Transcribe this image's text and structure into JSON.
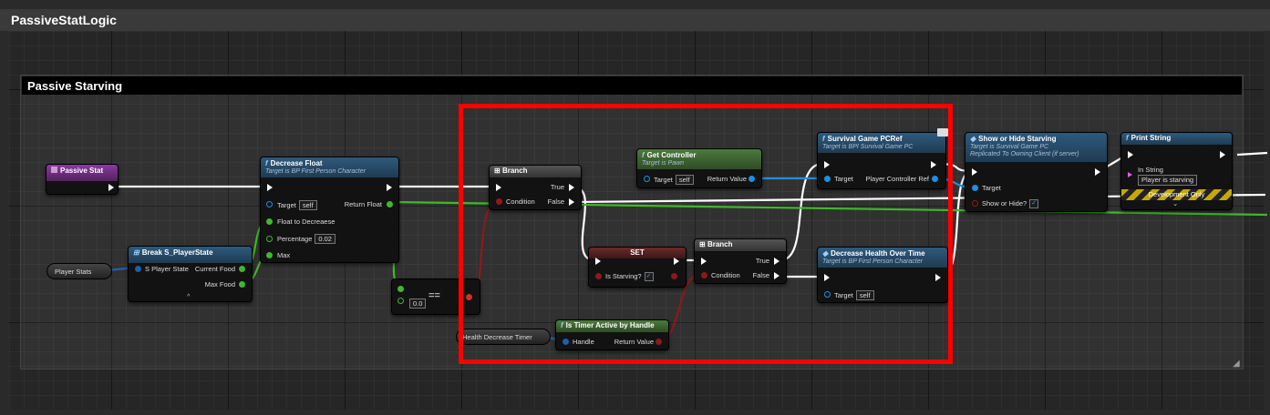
{
  "window": {
    "title": "PassiveStatLogic"
  },
  "comment": {
    "title": "Passive Starving"
  },
  "nodes": {
    "passive_stat": {
      "title": "Passive Stat"
    },
    "player_stats_var": {
      "label": "Player Stats"
    },
    "break_struct": {
      "title": "Break S_PlayerState",
      "input": "S Player State",
      "out1": "Current Food",
      "out2": "Max Food",
      "expand": "^"
    },
    "decrease_float": {
      "title": "Decrease Float",
      "subtitle": "Target is BP First Person Character",
      "target": "Target",
      "target_val": "self",
      "return": "Return Float",
      "float_to_decrease": "Float to Decreaese",
      "percentage": "Percentage",
      "percentage_val": "0.02",
      "max": "Max"
    },
    "equals": {
      "op": "==",
      "val": "0.0"
    },
    "branch1": {
      "title": "Branch",
      "true": "True",
      "false": "False",
      "condition": "Condition"
    },
    "get_controller": {
      "title": "Get Controller",
      "subtitle": "Target is Pawn",
      "target": "Target",
      "target_val": "self",
      "return": "Return Value"
    },
    "set_node": {
      "title": "SET",
      "var": "Is Starving?"
    },
    "branch2": {
      "title": "Branch",
      "true": "True",
      "false": "False",
      "condition": "Condition"
    },
    "timer_var": {
      "label": "Health Decrease Timer"
    },
    "is_timer_active": {
      "title": "Is Timer Active by Handle",
      "handle": "Handle",
      "return": "Return Value"
    },
    "survival_pcref": {
      "title": "Survival Game PCRef",
      "subtitle": "Target is BPI Survival Game PC",
      "target": "Target",
      "out": "Player Controller Ref"
    },
    "decrease_health": {
      "title": "Decrease Health Over Time",
      "subtitle": "Target is BP First Person Character",
      "target": "Target",
      "target_val": "self"
    },
    "show_hide": {
      "title": "Show or Hide Starving",
      "subtitle1": "Target is Survival Game PC",
      "subtitle2": "Replicated To Owning Client (if server)",
      "target": "Target",
      "show": "Show or Hide?"
    },
    "print_string": {
      "title": "Print String",
      "in_string": "In String",
      "in_string_val": "Player is starving",
      "dev_only": "Development Only",
      "expand": "⌄"
    }
  },
  "colors": {
    "highlight": "#ff0000",
    "exec": "#ffffff",
    "bool": "#8c1a1a",
    "float": "#3fb82b",
    "object": "#1e8fe0",
    "struct": "#1a5fb4"
  }
}
